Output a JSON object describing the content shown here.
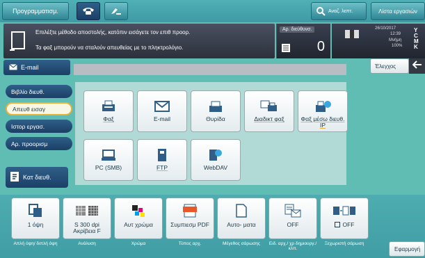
{
  "topbar": {
    "program_label": "Προγραμματισμ.",
    "search_label": "Αναζ. λεπτ.",
    "job_list_label": "Λίστα εργασιών"
  },
  "message": {
    "line1": "Επιλέξτε μέθοδο αποστολής, κατόπιν εισάγετε τον επιθ προορ.",
    "line2": "Τα φαξ μπορούν να σταλούν απευθείας με το πληκτρολόγιο."
  },
  "counter": {
    "label": "Αρ. διεύθυνσ.",
    "value": "0"
  },
  "status": {
    "date": "26/10/2017",
    "time": "12:39",
    "memory_label": "Μνήμη",
    "memory_value": "100%",
    "toner_letters": [
      "Y",
      "C",
      "M",
      "K"
    ]
  },
  "destination": {
    "tab_label": "E-mail",
    "check_label": "Έλεγχος",
    "value": ""
  },
  "side_tabs": [
    {
      "label": "Βιβλίο διευθ."
    },
    {
      "label": "Απευθ εισαγ",
      "selected": true
    },
    {
      "label": "Ιστορ εργασ."
    },
    {
      "label": "Αρ. προορισμ"
    }
  ],
  "address_book_button": "Κατ διευθ.",
  "methods": [
    {
      "label": "Φαξ",
      "icon": "fax-icon"
    },
    {
      "label": "E-mail",
      "icon": "envelope-icon"
    },
    {
      "label": "Θυρίδα",
      "icon": "box-icon"
    },
    {
      "label": "Διαδικτ φαξ",
      "icon": "internet-fax-icon"
    },
    {
      "label": "Φαξ μέσω διευθ. IP",
      "icon": "ip-fax-icon"
    },
    {
      "label": "PC (SMB)",
      "icon": "pc-icon"
    },
    {
      "label": "FTP",
      "icon": "ftp-icon"
    },
    {
      "label": "WebDAV",
      "icon": "webdav-icon"
    }
  ],
  "quick_settings": [
    {
      "value": "1 όψη",
      "label": "Απλή όψη/ διπλή όψη",
      "icon": "simplex-icon"
    },
    {
      "value": "S 300 dpi Ακρίβεια F",
      "label": "Ανάλυση",
      "icon": "resolution-icon"
    },
    {
      "value": "Αυτ χρώμα",
      "label": "Χρώμα",
      "icon": "color-icon"
    },
    {
      "value": "Συμπιεσμ PDF",
      "label": "Τύπος αρχ.",
      "icon": "pdf-icon"
    },
    {
      "value": "Αυτο- ματα",
      "label": "Μέγεθος σάρωσης",
      "icon": "scan-size-icon"
    },
    {
      "value": "OFF",
      "label": "Ειδ. αρχ./ χρ δημιουργ./ κλπ.",
      "icon": "file-notify-icon"
    },
    {
      "value": "OFF",
      "label": "Ξεχωριστή σάρωση",
      "icon": "separate-scan-icon"
    }
  ],
  "apply_label": "Εφαρμογή"
}
